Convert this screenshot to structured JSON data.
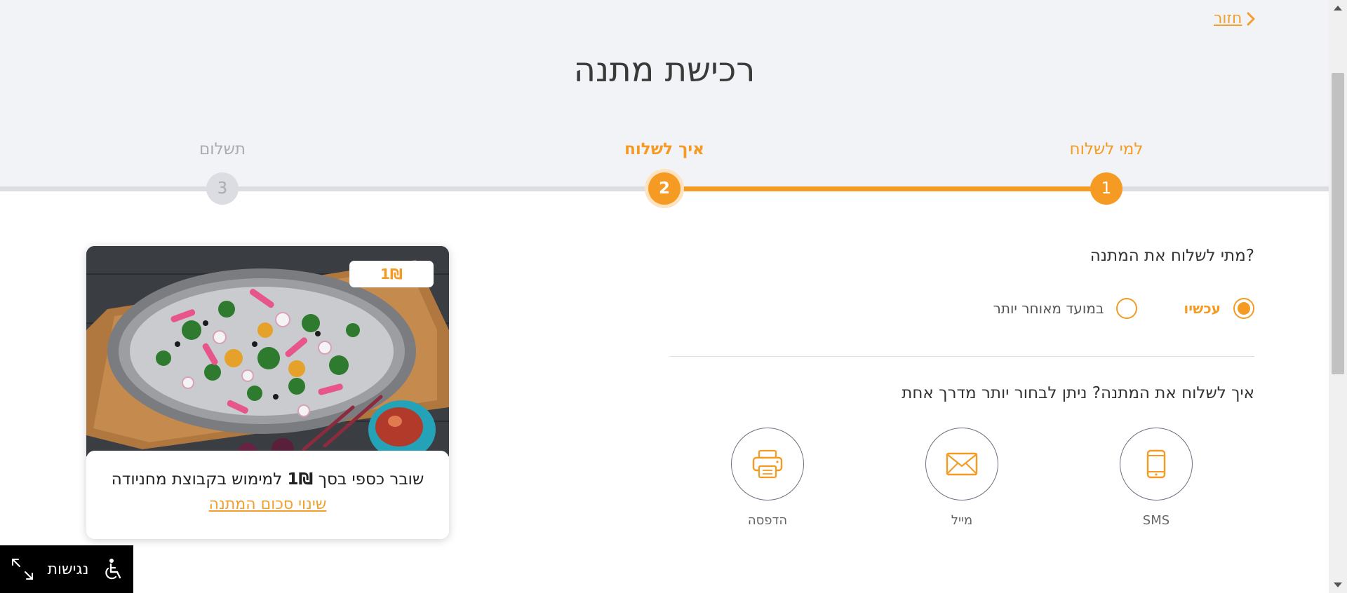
{
  "header": {
    "back_label": "חזור",
    "title": "רכישת מתנה"
  },
  "steps": [
    {
      "number": "1",
      "label": "למי לשלוח",
      "state": "done"
    },
    {
      "number": "2",
      "label": "איך לשלוח",
      "state": "active"
    },
    {
      "number": "3",
      "label": "תשלום",
      "state": "todo"
    }
  ],
  "progress": {
    "completed_steps": 1,
    "total_steps": 3
  },
  "when": {
    "question": "מתי לשלוח את המתנה?",
    "options": [
      {
        "label": "עכשיו",
        "selected": true
      },
      {
        "label": "במועד מאוחר יותר",
        "selected": false
      }
    ]
  },
  "how": {
    "question": "איך לשלוח את המתנה? ניתן לבחור יותר מדרך אחת",
    "methods": [
      {
        "label": "SMS",
        "icon": "phone-icon"
      },
      {
        "label": "מייל",
        "icon": "envelope-icon"
      },
      {
        "label": "הדפסה",
        "icon": "printer-icon"
      }
    ]
  },
  "gift_card": {
    "price_badge": "1₪",
    "desc_prefix": "שובר כספי בסך ",
    "desc_amount": "1₪",
    "desc_suffix": " למימוש בקבוצת מחניודה",
    "change_link": "שינוי סכום המתנה"
  },
  "accessibility": {
    "label": "נגישות"
  },
  "colors": {
    "accent": "#f59b23",
    "band": "#f2f3f6",
    "inactive": "#a9abb2"
  }
}
